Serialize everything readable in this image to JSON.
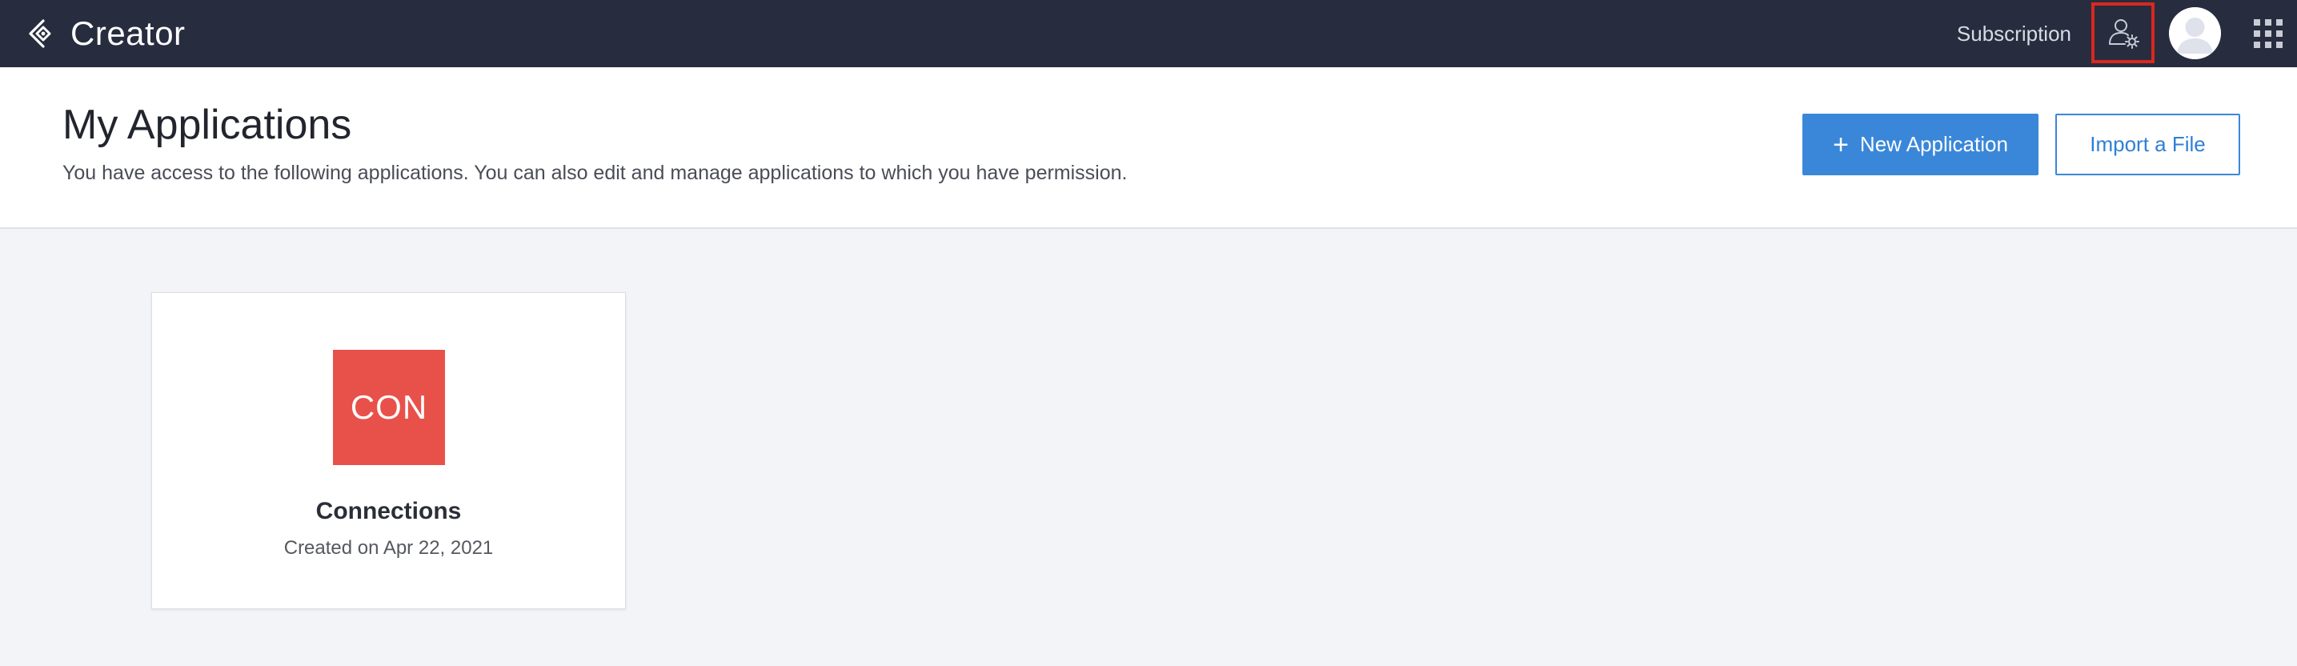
{
  "topbar": {
    "brand_name": "Creator",
    "subscription_label": "Subscription"
  },
  "header": {
    "title": "My Applications",
    "subtitle": "You have access to the following applications. You can also edit and manage applications to which you have permission.",
    "new_application_label": "New Application",
    "import_label": "Import a File"
  },
  "applications": [
    {
      "tile_text": "CON",
      "name": "Connections",
      "created": "Created on Apr 22, 2021",
      "tile_color": "#e8514a"
    }
  ],
  "colors": {
    "topbar_bg": "#272d3f",
    "accent_blue": "#3a87d9",
    "highlight_red": "#d9281e",
    "page_bg": "#f3f4f8"
  },
  "icons": {
    "brand": "creator-logo-icon",
    "admin": "user-settings-icon",
    "avatar": "user-avatar-icon",
    "apps": "grid-icon",
    "add": "plus-icon"
  }
}
